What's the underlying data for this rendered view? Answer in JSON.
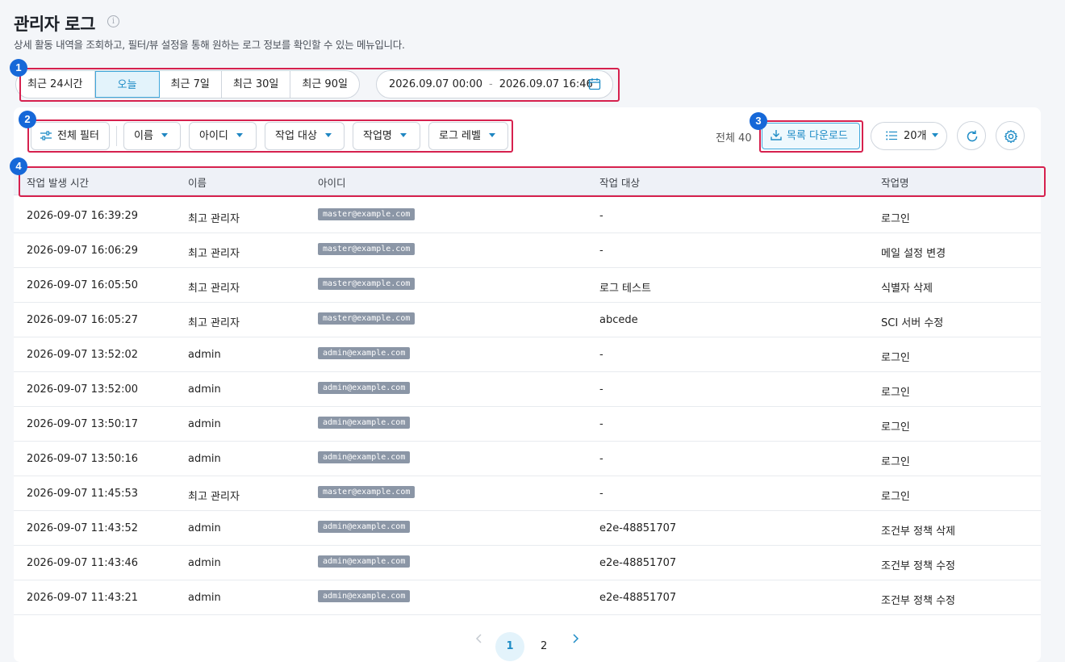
{
  "header": {
    "title": "관리자 로그",
    "description": "상세 활동 내역을 조회하고, 필터/뷰 설정을 통해 원하는 로그 정보를 확인할 수 있는 메뉴입니다."
  },
  "annotations": [
    "1",
    "2",
    "3",
    "4"
  ],
  "period": {
    "options": [
      "최근 24시간",
      "오늘",
      "최근 7일",
      "최근 30일",
      "최근 90일"
    ],
    "selected": "오늘",
    "date_from": "2026.09.07 00:00",
    "date_sep": "-",
    "date_to": "2026.09.07 16:46"
  },
  "toolbar": {
    "all_filter": "전체 필터",
    "filters": [
      "이름",
      "아이디",
      "작업 대상",
      "작업명",
      "로그 레벨"
    ],
    "total_label": "전체 40",
    "download_label": "목록 다운로드",
    "page_size": "20개"
  },
  "table": {
    "headers": [
      "작업 발생 시간",
      "이름",
      "아이디",
      "작업 대상",
      "작업명"
    ],
    "rows": [
      {
        "time": "2026-09-07 16:39:29",
        "name": "최고 관리자",
        "id": "master@example.com",
        "target": "-",
        "action": "로그인"
      },
      {
        "time": "2026-09-07 16:06:29",
        "name": "최고 관리자",
        "id": "master@example.com",
        "target": "-",
        "action": "메일 설정 변경"
      },
      {
        "time": "2026-09-07 16:05:50",
        "name": "최고 관리자",
        "id": "master@example.com",
        "target": "로그 테스트",
        "action": "식별자 삭제"
      },
      {
        "time": "2026-09-07 16:05:27",
        "name": "최고 관리자",
        "id": "master@example.com",
        "target": "abcede",
        "action": "SCI 서버 수정"
      },
      {
        "time": "2026-09-07 13:52:02",
        "name": "admin",
        "id": "admin@example.com",
        "target": "-",
        "action": "로그인"
      },
      {
        "time": "2026-09-07 13:52:00",
        "name": "admin",
        "id": "admin@example.com",
        "target": "-",
        "action": "로그인"
      },
      {
        "time": "2026-09-07 13:50:17",
        "name": "admin",
        "id": "admin@example.com",
        "target": "-",
        "action": "로그인"
      },
      {
        "time": "2026-09-07 13:50:16",
        "name": "admin",
        "id": "admin@example.com",
        "target": "-",
        "action": "로그인"
      },
      {
        "time": "2026-09-07 11:45:53",
        "name": "최고 관리자",
        "id": "master@example.com",
        "target": "-",
        "action": "로그인"
      },
      {
        "time": "2026-09-07 11:43:52",
        "name": "admin",
        "id": "admin@example.com",
        "target": "e2e-48851707",
        "action": "조건부 정책 삭제"
      },
      {
        "time": "2026-09-07 11:43:46",
        "name": "admin",
        "id": "admin@example.com",
        "target": "e2e-48851707",
        "action": "조건부 정책 수정"
      },
      {
        "time": "2026-09-07 11:43:21",
        "name": "admin",
        "id": "admin@example.com",
        "target": "e2e-48851707",
        "action": "조건부 정책 수정"
      }
    ]
  },
  "pagination": {
    "pages": [
      "1",
      "2"
    ],
    "current": "1"
  },
  "colors": {
    "accent": "#1e8cc6",
    "annotation_badge": "#1668d8",
    "annotation_box": "#d6214e",
    "email_chip": "#8b96a6"
  },
  "icons": [
    "info-icon",
    "calendar-icon",
    "filter-sliders-icon",
    "chevron-down-icon",
    "download-icon",
    "list-icon",
    "refresh-icon",
    "gear-icon",
    "chevron-left-icon",
    "chevron-right-icon"
  ]
}
